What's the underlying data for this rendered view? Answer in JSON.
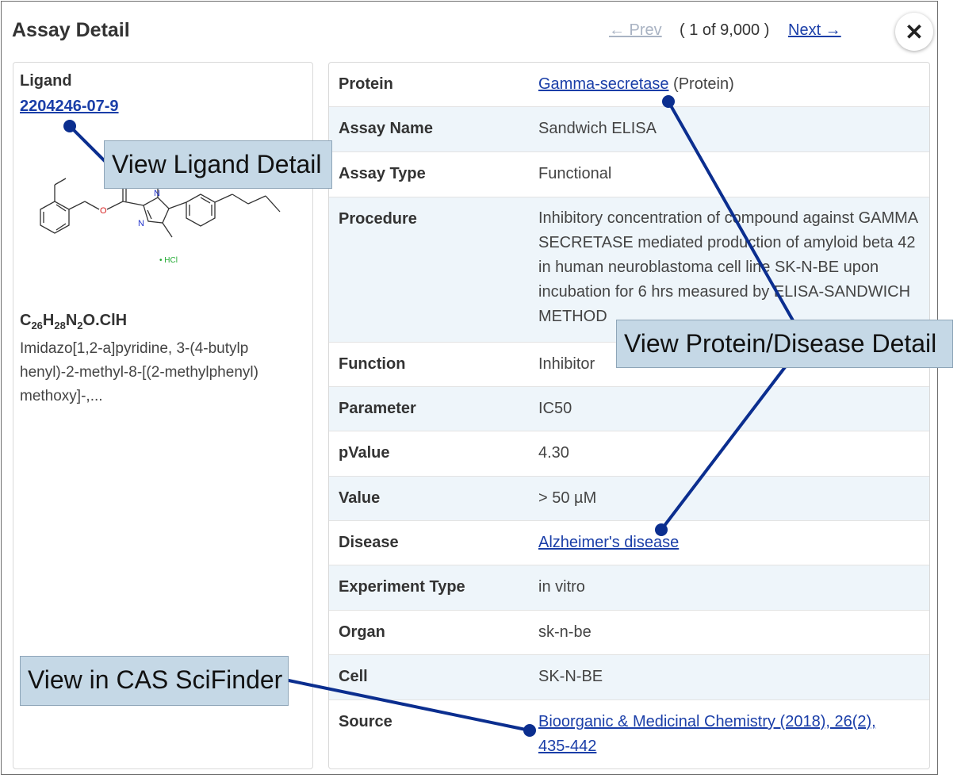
{
  "header": {
    "title": "Assay Detail",
    "prev_label": "← Prev",
    "count_label": "( 1 of 9,000 )",
    "next_label": "Next →",
    "close_glyph": "✕"
  },
  "ligand": {
    "label": "Ligand",
    "cas_number": "2204246-07-9",
    "formula_parts": [
      "C",
      "26",
      "H",
      "28",
      "N",
      "2",
      "O.ClH"
    ],
    "name": "Imidazo[1,2-a]pyridine, 3-(4-butylp henyl)-2-methyl-8-[(2-methylphenyl) methoxy]-,...",
    "structure_atoms": {
      "o": "O",
      "n1": "N",
      "n2": "N",
      "salt": "• HCl"
    }
  },
  "details": {
    "protein": {
      "label": "Protein",
      "link": "Gamma-secretase",
      "suffix": " (Protein)"
    },
    "assay_name": {
      "label": "Assay Name",
      "value": "Sandwich ELISA"
    },
    "assay_type": {
      "label": "Assay Type",
      "value": "Functional"
    },
    "procedure": {
      "label": "Procedure",
      "value": "Inhibitory concentration of compound against GAMMA SECRETASE mediated production of amyloid beta 42 in human neuroblastoma cell line SK-N-BE upon incubation for 6 hrs measured by ELISA-SANDWICH METHOD"
    },
    "function": {
      "label": "Function",
      "value": "Inhibitor"
    },
    "parameter": {
      "label": "Parameter",
      "value": "IC50"
    },
    "pvalue": {
      "label": "pValue",
      "value": "4.30"
    },
    "value": {
      "label": "Value",
      "value": "> 50 µM"
    },
    "disease": {
      "label": "Disease",
      "link": "Alzheimer's disease"
    },
    "experiment_type": {
      "label": "Experiment Type",
      "value": "in vitro"
    },
    "organ": {
      "label": "Organ",
      "value": "sk-n-be"
    },
    "cell": {
      "label": "Cell",
      "value": "SK-N-BE"
    },
    "source": {
      "label": "Source",
      "link": "Bioorganic & Medicinal Chemistry (2018), 26(2), 435-442"
    }
  },
  "callouts": {
    "ligand": "View Ligand Detail",
    "protein_disease": "View Protein/Disease Detail",
    "scifinder": "View in CAS SciFinder"
  },
  "colors": {
    "link": "#1a3ea8",
    "callout_bg": "#c5d8e6",
    "pointer": "#0b2e8f",
    "row_alt": "#eef5fa"
  }
}
